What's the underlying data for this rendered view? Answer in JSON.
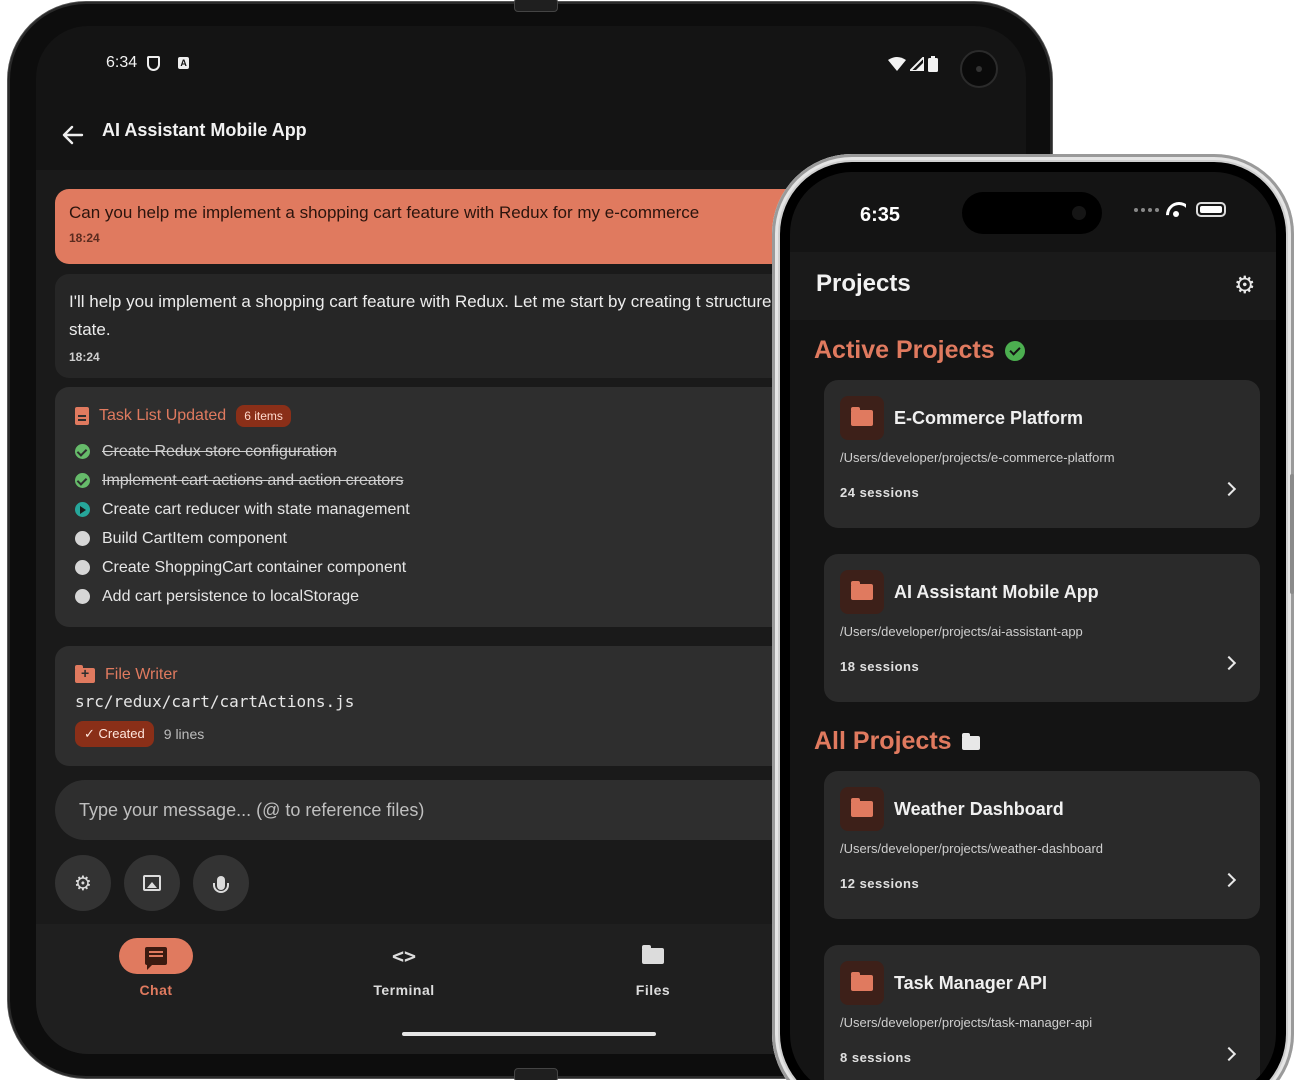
{
  "tablet": {
    "status": {
      "time": "6:34",
      "a_badge": "A"
    },
    "appbar": {
      "title": "AI Assistant Mobile App"
    },
    "messages": {
      "user": {
        "text": "Can you help me implement a shopping cart feature with Redux for my e-commerce",
        "time": "18:24"
      },
      "assistant": {
        "text": "I'll help you implement a shopping cart feature with Redux. Let me start by creating t structure for managing cart state.",
        "time": "18:24"
      }
    },
    "task_card": {
      "title": "Task List Updated",
      "count": "6 items",
      "tasks": [
        {
          "label": "Create Redux store configuration",
          "status": "done"
        },
        {
          "label": "Implement cart actions and action creators",
          "status": "done"
        },
        {
          "label": "Create cart reducer with state management",
          "status": "active"
        },
        {
          "label": "Build CartItem component",
          "status": "pending"
        },
        {
          "label": "Create ShoppingCart container component",
          "status": "pending"
        },
        {
          "label": "Add cart persistence to localStorage",
          "status": "pending"
        }
      ]
    },
    "file_card": {
      "title": "File Writer",
      "path": "src/redux/cart/cartActions.js",
      "badge": "✓ Created",
      "lines": "9 lines"
    },
    "input": {
      "placeholder": "Type your message... (@ to reference files)"
    },
    "nav": {
      "chat": "Chat",
      "terminal": "Terminal",
      "files": "Files"
    }
  },
  "phone": {
    "status": {
      "time": "6:35"
    },
    "header": {
      "title": "Projects"
    },
    "active_title": "Active Projects",
    "all_title": "All Projects",
    "active_projects": [
      {
        "name": "E-Commerce Platform",
        "path": "/Users/developer/projects/e-commerce-platform",
        "sessions": "24 sessions"
      },
      {
        "name": "AI Assistant Mobile App",
        "path": "/Users/developer/projects/ai-assistant-app",
        "sessions": "18 sessions"
      }
    ],
    "all_projects": [
      {
        "name": "Weather Dashboard",
        "path": "/Users/developer/projects/weather-dashboard",
        "sessions": "12 sessions"
      },
      {
        "name": "Task Manager API",
        "path": "/Users/developer/projects/task-manager-api",
        "sessions": "8 sessions"
      }
    ]
  },
  "colors": {
    "accent": "#e07a5f",
    "background": "#141414",
    "card": "#2a2a2a",
    "success": "#66bb6a",
    "in_progress": "#26a69a"
  }
}
